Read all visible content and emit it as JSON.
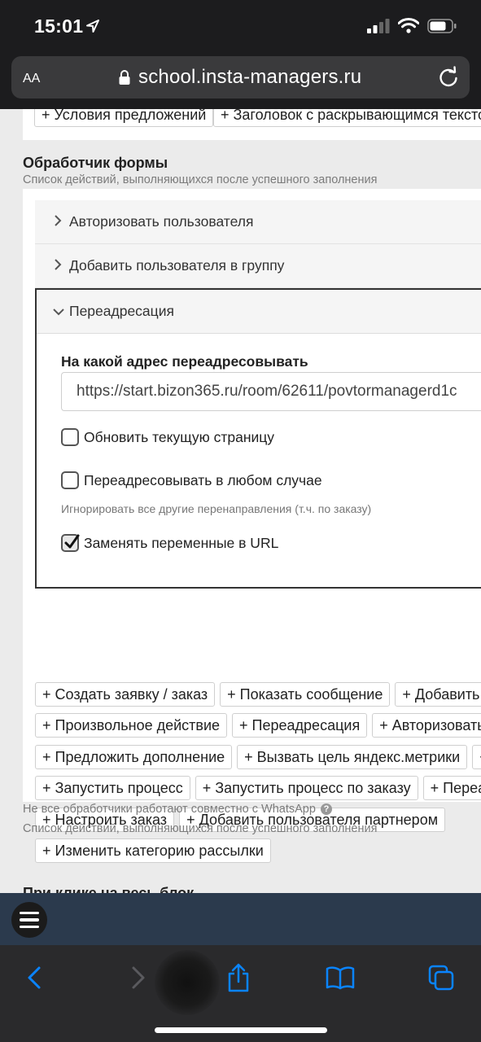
{
  "status_bar": {
    "time": "15:01"
  },
  "browser": {
    "aa_label": "AA",
    "url": "school.insta-managers.ru"
  },
  "page": {
    "top_chips": [
      "+ Условия предложений",
      "+ Заголовок с раскрывающимся тексто"
    ],
    "section_title": "Обработчик формы",
    "section_subtitle": "Список действий, выполняющихся после успешного заполнения",
    "accordion": {
      "collapsed": [
        "Авторизовать пользователя",
        "Добавить пользователя в группу"
      ],
      "open_title": "Переадресация",
      "field_label": "На какой адрес переадресовывать",
      "url_value": "https://start.bizon365.ru/room/62611/povtormanagerd1c",
      "checkboxes": [
        {
          "label": "Обновить текущую страницу",
          "checked": false
        },
        {
          "label": "Переадресовывать в любом случае",
          "checked": false
        },
        {
          "label": "Заменять переменные в URL",
          "checked": true
        }
      ],
      "hint": "Игнорировать все другие перенаправления (т.ч. по заказу)"
    },
    "action_rows": [
      [
        "+ Создать заявку / заказ",
        "+ Показать сообщение",
        "+ Добавить по"
      ],
      [
        "+ Произвольное действие",
        "+ Переадресация",
        "+ Авторизовать по"
      ],
      [
        "+ Предложить дополнение",
        "+ Вызвать цель яндекс.метрики",
        "+ С"
      ],
      [
        "+ Запустить процесс",
        "+ Запустить процесс по заказу",
        "+ Переадр"
      ],
      [
        "+ Настроить заказ",
        "+ Добавить пользователя партнером"
      ],
      [
        "+ Изменить категорию рассылки"
      ]
    ],
    "note": "Не все обработчики работают совместно с WhatsApp",
    "note_subtitle": "Список действий, выполняющихся после успешного заполнения",
    "next_section_title": "При клике на весь блок"
  },
  "colors": {
    "chrome": "#1c1c1e",
    "url_bar": "#3a3a3c",
    "ios_blue": "#0a84ff",
    "app_bar": "#2b3a4d",
    "page_bg": "#ebebeb"
  }
}
